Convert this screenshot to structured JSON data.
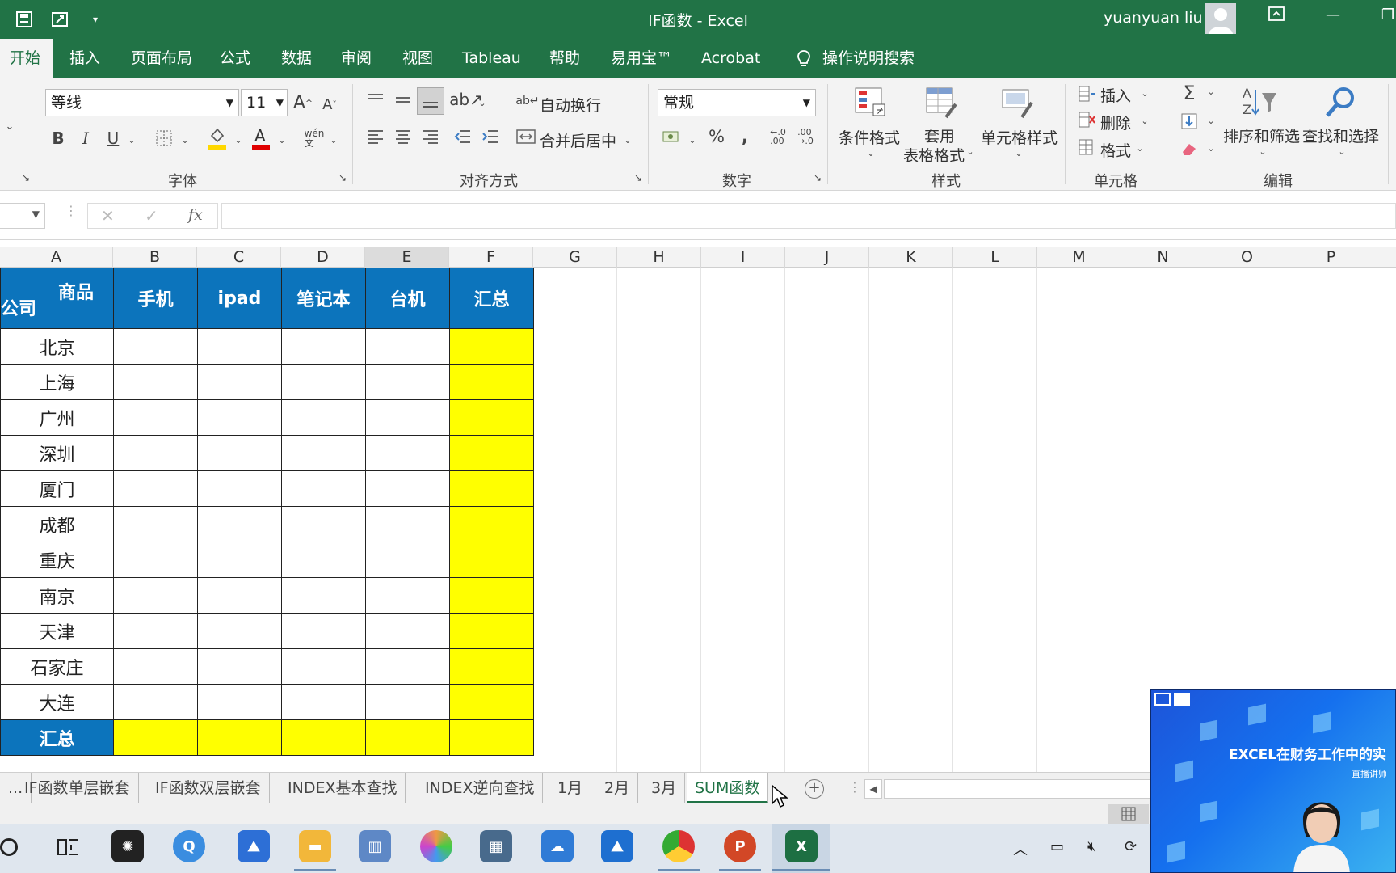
{
  "titlebar": {
    "title": "IF函数  -  Excel",
    "user_name": "yuanyuan liu",
    "icons": [
      "save-icon",
      "touch-mode-icon",
      "customize-qat-icon",
      "ribbon-display-icon",
      "minimize-icon",
      "restore-icon"
    ]
  },
  "ribbon_tabs": [
    "开始",
    "插入",
    "页面布局",
    "公式",
    "数据",
    "审阅",
    "视图",
    "Tableau",
    "帮助",
    "易用宝™",
    "Acrobat",
    "操作说明搜索"
  ],
  "active_tab": "开始",
  "font_group": {
    "font_name": "等线",
    "font_size": "11",
    "label": "字体",
    "fill_color": "#ffd800",
    "font_color": "#e00000"
  },
  "alignment_group": {
    "wrap_text": "自动换行",
    "merge_center": "合并后居中",
    "label": "对齐方式"
  },
  "number_group": {
    "format": "常规",
    "label": "数字"
  },
  "styles_group": {
    "conditional_format": "条件格式",
    "table_format_line1": "套用",
    "table_format_line2": "表格格式",
    "cell_styles": "单元格样式",
    "label": "样式"
  },
  "cells_group": {
    "insert": "插入",
    "delete": "删除",
    "format": "格式",
    "label": "单元格"
  },
  "editing_group": {
    "sort_filter": "排序和筛选",
    "find_select": "查找和选择",
    "label": "编辑"
  },
  "formula_bar": {
    "fx": "fx",
    "content": ""
  },
  "columns": [
    "A",
    "B",
    "C",
    "D",
    "E",
    "F",
    "G",
    "H",
    "I",
    "J",
    "K",
    "L",
    "M",
    "N",
    "O",
    "P"
  ],
  "table": {
    "corner_top": "商品",
    "corner_bottom": "公司",
    "headers": [
      "手机",
      "ipad",
      "笔记本",
      "台机",
      "汇总"
    ],
    "rows": [
      "北京",
      "上海",
      "广州",
      "深圳",
      "厦门",
      "成都",
      "重庆",
      "南京",
      "天津",
      "石家庄",
      "大连"
    ],
    "total_label": "汇总",
    "header_color": "#0c74bc",
    "highlight_color": "#ffff00"
  },
  "sheet_tabs": [
    "...",
    "IF函数单层嵌套",
    "IF函数双层嵌套",
    "INDEX基本查找",
    "INDEX逆向查找",
    "1月",
    "2月",
    "3月",
    "SUM函数"
  ],
  "active_sheet": "SUM函数",
  "video": {
    "title": "EXCEL在财务工作中的实",
    "subtitle": "直播讲师"
  }
}
